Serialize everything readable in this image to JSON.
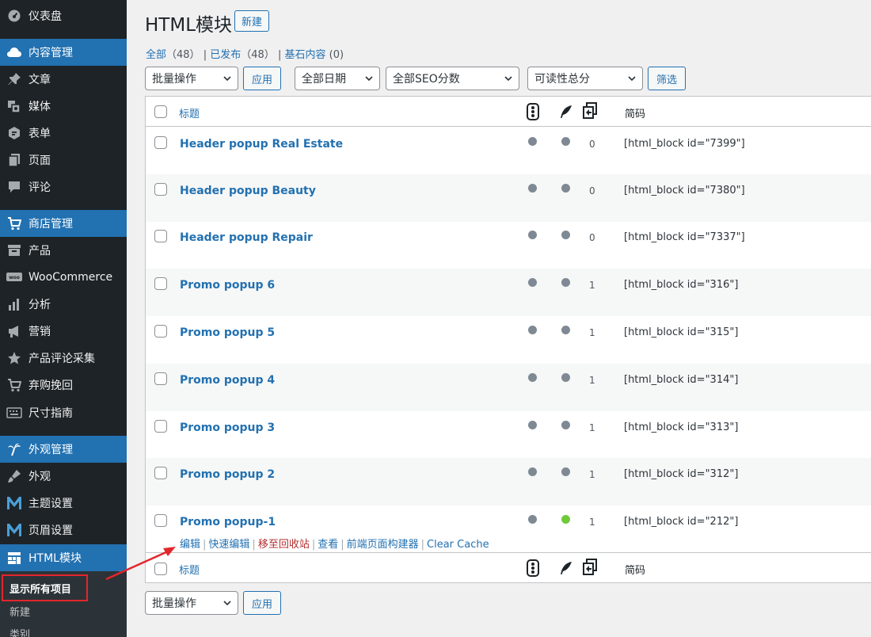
{
  "sidebar": {
    "items": [
      {
        "label": "仪表盘",
        "icon": "dashboard-icon",
        "highlight": false
      },
      {
        "label": "内容管理",
        "icon": "cloud-icon",
        "highlight": true
      },
      {
        "label": "文章",
        "icon": "pin-icon",
        "highlight": false
      },
      {
        "label": "媒体",
        "icon": "media-icon",
        "highlight": false
      },
      {
        "label": "表单",
        "icon": "form-icon",
        "highlight": false
      },
      {
        "label": "页面",
        "icon": "page-icon",
        "highlight": false
      },
      {
        "label": "评论",
        "icon": "comment-icon",
        "highlight": false
      },
      {
        "label": "商店管理",
        "icon": "cart-icon",
        "highlight": true
      },
      {
        "label": "产品",
        "icon": "archive-icon",
        "highlight": false
      },
      {
        "label": "WooCommerce",
        "icon": "woo-icon",
        "highlight": false
      },
      {
        "label": "分析",
        "icon": "chart-icon",
        "highlight": false
      },
      {
        "label": "营销",
        "icon": "megaphone-icon",
        "highlight": false
      },
      {
        "label": "产品评论采集",
        "icon": "star-icon",
        "highlight": false
      },
      {
        "label": "弃购挽回",
        "icon": "cart-icon",
        "highlight": false
      },
      {
        "label": "尺寸指南",
        "icon": "keyboard-icon",
        "highlight": false
      },
      {
        "label": "外观管理",
        "icon": "palm-icon",
        "highlight": true
      },
      {
        "label": "外观",
        "icon": "brush-icon",
        "highlight": false
      },
      {
        "label": "主题设置",
        "icon": "m-logo-icon",
        "highlight": false
      },
      {
        "label": "页眉设置",
        "icon": "m-logo-icon",
        "highlight": false
      },
      {
        "label": "HTML模块",
        "icon": "grid-icon",
        "highlight": true
      }
    ],
    "submenu": [
      {
        "label": "显示所有项目",
        "current": true
      },
      {
        "label": "新建",
        "current": false
      },
      {
        "label": "类别",
        "current": false
      }
    ]
  },
  "page": {
    "title": "HTML模块",
    "new_button": "新建"
  },
  "filters": {
    "all_label": "全部",
    "all_count": "（48）",
    "published_label": "已发布",
    "published_count": "（48）",
    "cornerstone_label": "基石内容",
    "cornerstone_count": "(0)",
    "sep": "|"
  },
  "toolbar": {
    "bulk_action": "批量操作",
    "apply": "应用",
    "date_filter": "全部日期",
    "seo_filter": "全部SEO分数",
    "readability_filter": "可读性总分",
    "filter_button": "筛选"
  },
  "table": {
    "col_title": "标题",
    "col_shortcode": "简码",
    "rows": [
      {
        "title": "Header popup Real Estate",
        "seo": "gray",
        "readability": "gray",
        "links": "0",
        "shortcode": "[html_block id=\"7399\"]"
      },
      {
        "title": "Header popup Beauty",
        "seo": "gray",
        "readability": "gray",
        "links": "0",
        "shortcode": "[html_block id=\"7380\"]"
      },
      {
        "title": "Header popup Repair",
        "seo": "gray",
        "readability": "gray",
        "links": "0",
        "shortcode": "[html_block id=\"7337\"]"
      },
      {
        "title": "Promo popup 6",
        "seo": "gray",
        "readability": "gray",
        "links": "1",
        "shortcode": "[html_block id=\"316\"]"
      },
      {
        "title": "Promo popup 5",
        "seo": "gray",
        "readability": "gray",
        "links": "1",
        "shortcode": "[html_block id=\"315\"]"
      },
      {
        "title": "Promo popup 4",
        "seo": "gray",
        "readability": "gray",
        "links": "1",
        "shortcode": "[html_block id=\"314\"]"
      },
      {
        "title": "Promo popup 3",
        "seo": "gray",
        "readability": "gray",
        "links": "1",
        "shortcode": "[html_block id=\"313\"]"
      },
      {
        "title": "Promo popup 2",
        "seo": "gray",
        "readability": "gray",
        "links": "1",
        "shortcode": "[html_block id=\"312\"]"
      },
      {
        "title": "Promo popup-1",
        "seo": "gray",
        "readability": "green",
        "links": "1",
        "shortcode": "[html_block id=\"212\"]"
      }
    ],
    "row_actions": {
      "edit": "编辑",
      "quick_edit": "快速编辑",
      "trash": "移至回收站",
      "view": "查看",
      "builder": "前端页面构建器",
      "clear_cache": "Clear Cache",
      "sep": "|"
    }
  },
  "bottom_toolbar": {
    "bulk_action": "批量操作",
    "apply": "应用"
  },
  "colors": {
    "sidebar_bg": "#1d2327",
    "accent": "#2271b1",
    "annotation": "#e3262b",
    "green_dot": "#6fca3a",
    "gray_dot": "#7e8993"
  }
}
